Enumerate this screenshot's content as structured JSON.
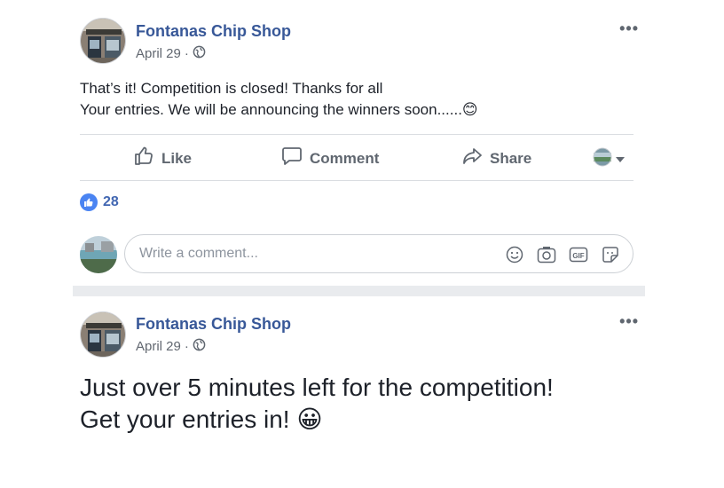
{
  "posts": [
    {
      "page_name": "Fontanas Chip Shop",
      "date": "April 29",
      "separator": "·",
      "text_line1": "That’s it! Competition is closed! Thanks for all",
      "text_line2": "Your entries. We will be announcing the winners soon......",
      "emoji": "😊",
      "more": "•••",
      "actions": {
        "like": "Like",
        "comment": "Comment",
        "share": "Share"
      },
      "reaction_count": "28",
      "comment_placeholder": "Write a comment..."
    },
    {
      "page_name": "Fontanas Chip Shop",
      "date": "April 29",
      "separator": "·",
      "text_line1": "Just over 5 minutes left for the competition!",
      "text_line2": "Get your entries in!",
      "emoji": "😀",
      "more": "•••"
    }
  ],
  "colors": {
    "link_blue": "#385898",
    "like_blue": "#4a84f2",
    "text": "#1d2129",
    "muted": "#606770",
    "divider": "#dadde1",
    "feed_gray": "#e9ebee"
  },
  "icons": [
    "globe-icon",
    "like-icon",
    "comment-icon",
    "share-icon",
    "audience-avatar-icon",
    "chevron-down-icon",
    "emoji-icon",
    "camera-icon",
    "gif-icon",
    "sticker-icon"
  ]
}
